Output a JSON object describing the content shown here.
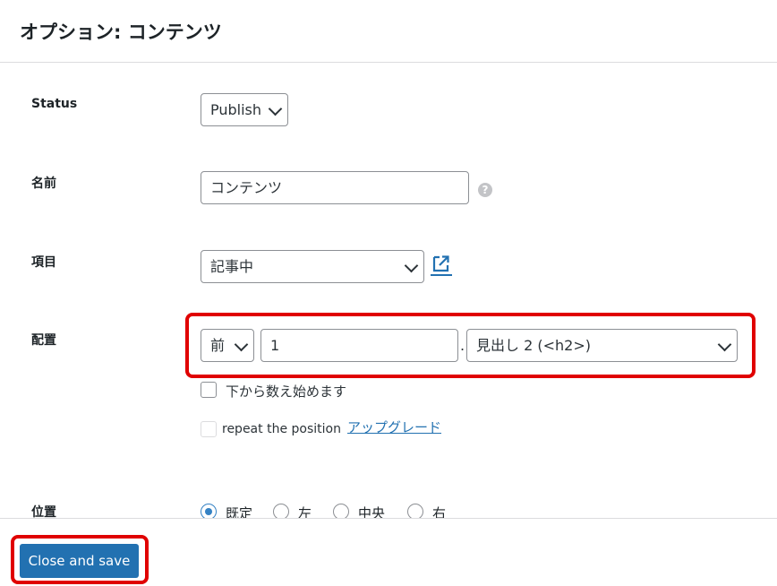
{
  "dialog": {
    "title": "オプション: コンテンツ"
  },
  "fields": {
    "status": {
      "label": "Status",
      "value": "Publish"
    },
    "name": {
      "label": "名前",
      "value": "コンテンツ",
      "help": "?"
    },
    "item": {
      "label": "項目",
      "value": "記事中"
    },
    "placement": {
      "label": "配置",
      "position_value": "前",
      "number_value": "1",
      "separator": ".",
      "heading_value": "見出し 2 (<h2>)",
      "count_from_bottom_label": "下から数え始めます",
      "repeat_label": "repeat the position",
      "upgrade_link": "アップグレード"
    },
    "alignment": {
      "label": "位置",
      "options": [
        "既定",
        "左",
        "中央",
        "右"
      ],
      "selected": "既定"
    }
  },
  "footer": {
    "save_label": "Close and save"
  },
  "colors": {
    "accent": "#2271b1",
    "highlight": "#e00000"
  }
}
